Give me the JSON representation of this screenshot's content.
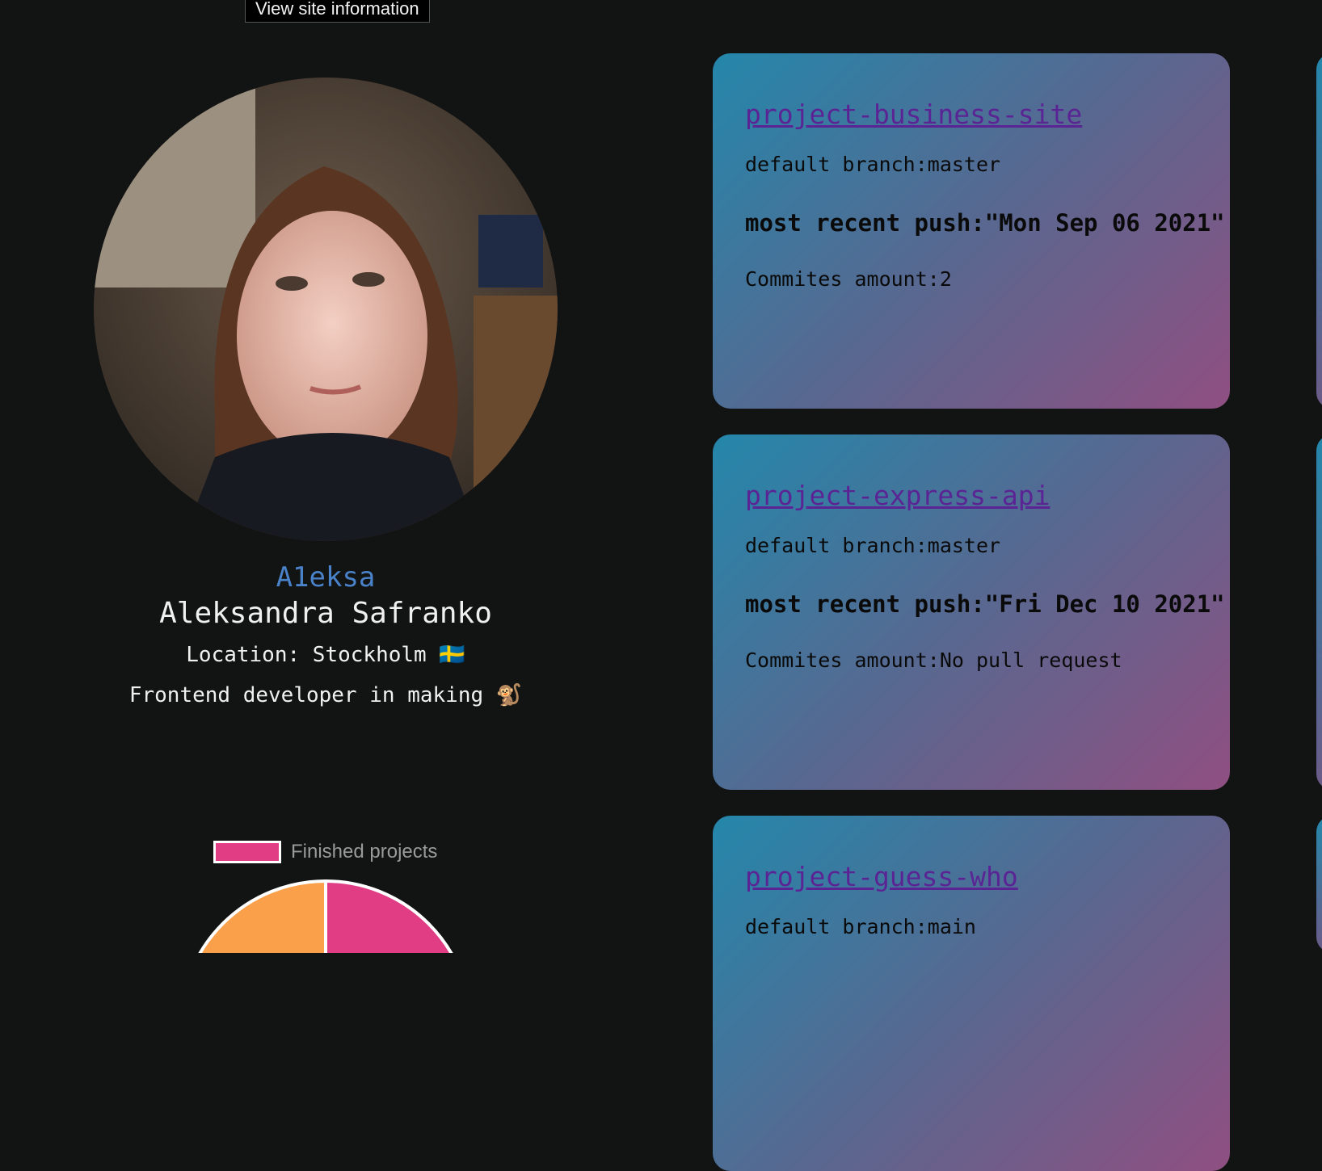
{
  "tooltip": {
    "label": "View site information"
  },
  "profile": {
    "username": "A1eksa",
    "full_name": "Aleksandra Safranko",
    "location": "Location: Stockholm 🇸🇪",
    "bio": "Frontend developer in making 🐒"
  },
  "chart_data": {
    "type": "pie",
    "legend": [
      "Finished projects"
    ],
    "colors": {
      "Finished projects": "#e03d84",
      "other": "#fa9f4a"
    },
    "legend_position": "top"
  },
  "projects": [
    {
      "name": "project-business-site",
      "branch": "default branch:master",
      "push": "most recent push:\"Mon Sep 06 2021\"",
      "commits": "Commites amount:2"
    },
    {
      "name": "project-express-api",
      "branch": "default branch:master",
      "push": "most recent push:\"Fri Dec 10 2021\"",
      "commits": "Commites amount:No pull request"
    },
    {
      "name": "project-guess-who",
      "branch": "default branch:main"
    }
  ],
  "colors": {
    "background": "#121313",
    "username": "#4a82c9",
    "link": "#5b2494",
    "card_gradient_start": "#2487ab",
    "card_gradient_end": "#8f4f81"
  }
}
